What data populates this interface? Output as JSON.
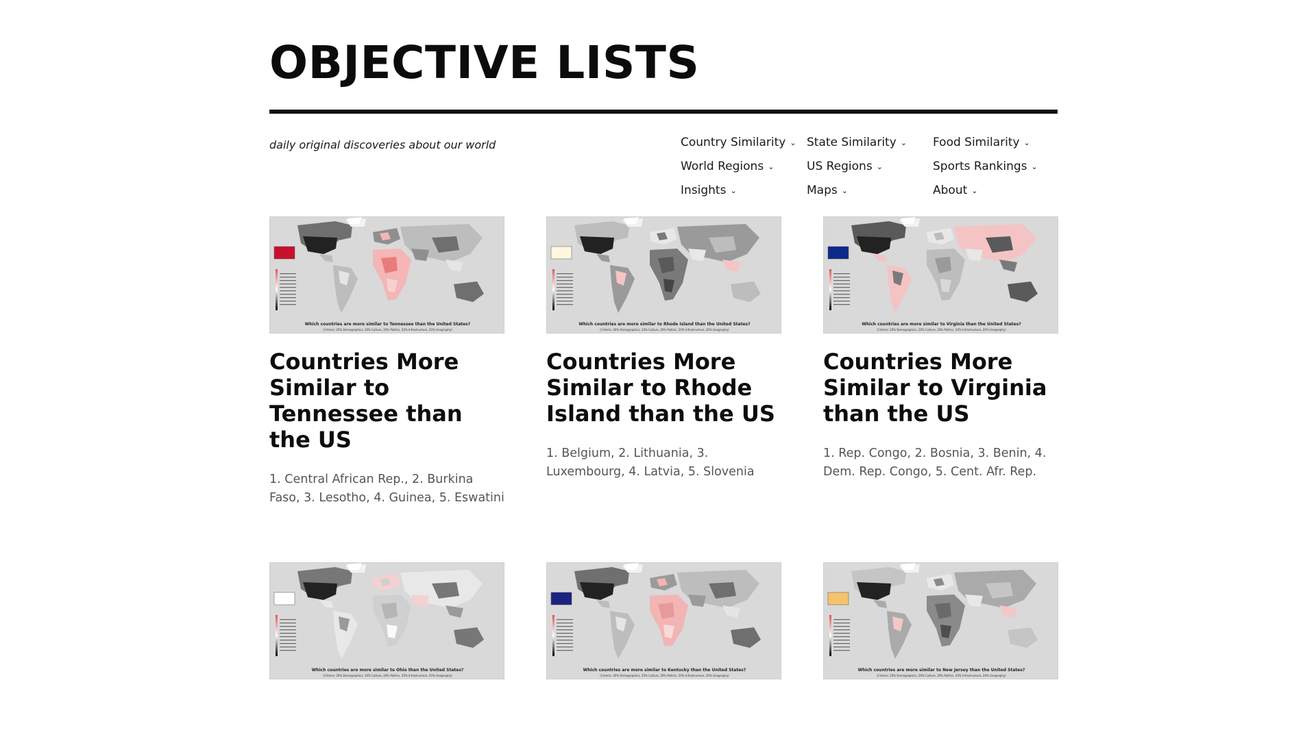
{
  "site": {
    "title": "OBJECTIVE LISTS",
    "tagline": "daily original discoveries about our world"
  },
  "nav": [
    {
      "label": "Country Similarity",
      "icon": "chevron-down-icon"
    },
    {
      "label": "State Similarity",
      "icon": "chevron-down-icon"
    },
    {
      "label": "Food Similarity",
      "icon": "chevron-down-icon"
    },
    {
      "label": "World Regions",
      "icon": "chevron-down-icon"
    },
    {
      "label": "US Regions",
      "icon": "chevron-down-icon"
    },
    {
      "label": "Sports Rankings",
      "icon": "chevron-down-icon"
    },
    {
      "label": "Insights",
      "icon": "chevron-down-icon"
    },
    {
      "label": "Maps",
      "icon": "chevron-down-icon"
    },
    {
      "label": "About",
      "icon": "chevron-down-icon"
    }
  ],
  "posts": [
    {
      "title": "Countries More Similar to Tennessee than the US",
      "excerpt": "1. Central African Rep., 2. Burkina Faso, 3. Lesotho, 4. Guinea, 5. Eswatini",
      "map_caption": "Which countries are more similar to Tennessee than the United States?",
      "flag_color": "#c8102e"
    },
    {
      "title": "Countries More Similar to Rhode Island than the US",
      "excerpt": "1. Belgium, 2. Lithuania, 3. Luxembourg, 4. Latvia, 5. Slovenia",
      "map_caption": "Which countries are more similar to Rhode Island than the United States?",
      "flag_color": "#fff7e0"
    },
    {
      "title": "Countries More Similar to Virginia than the US",
      "excerpt": "1. Rep. Congo, 2. Bosnia, 3. Benin, 4. Dem. Rep. Congo, 5. Cent. Afr. Rep.",
      "map_caption": "Which countries are more similar to Virginia than the United States?",
      "flag_color": "#0d2a8a"
    },
    {
      "title": "",
      "excerpt": "",
      "map_caption": "Which countries are more similar to Ohio than the United States?",
      "flag_color": "#ffffff"
    },
    {
      "title": "",
      "excerpt": "",
      "map_caption": "Which countries are more similar to Kentucky than the United States?",
      "flag_color": "#1a237e"
    },
    {
      "title": "",
      "excerpt": "",
      "map_caption": "Which countries are more similar to New Jersey than the United States?",
      "flag_color": "#f4c36b"
    }
  ],
  "map_criteria": "(Criteria: 20% Demographics, 20% Culture, 20% Politics, 20% Infrastructure, 20% Geography)"
}
